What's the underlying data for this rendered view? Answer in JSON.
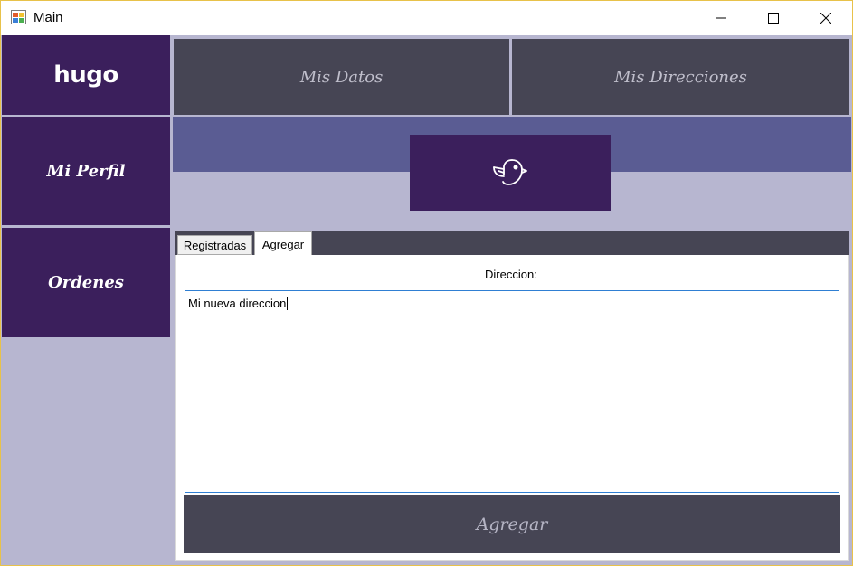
{
  "window": {
    "title": "Main"
  },
  "sidebar": {
    "logo": "hugo",
    "items": [
      {
        "label": "Mi Perfil"
      },
      {
        "label": "Ordenes"
      }
    ]
  },
  "top_tabs": [
    {
      "label": "Mis Datos"
    },
    {
      "label": "Mis Direcciones"
    }
  ],
  "header": {
    "icon": "bird-icon",
    "colors": {
      "band": "#5a5c93",
      "dark": "#3b1f5c",
      "button": "#464554"
    }
  },
  "address_tabs": [
    {
      "label": "Registradas",
      "selected": false
    },
    {
      "label": "Agregar",
      "selected": true
    }
  ],
  "form": {
    "label": "Direccion:",
    "value": "Mi nueva direccion",
    "submit_label": "Agregar"
  }
}
